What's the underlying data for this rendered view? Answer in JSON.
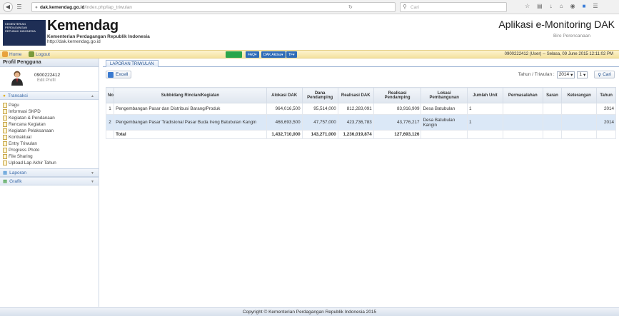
{
  "browser": {
    "url_host": "dak.kemendag.go.id",
    "url_path": "/index.php/lap_triwulan",
    "search_placeholder": "Cari"
  },
  "header": {
    "brand_title": "Kemendag",
    "brand_subtitle": "Kementerian Perdagangan Republik Indonesia",
    "brand_url": "http://dak.kemendag.go.id",
    "app_title": "Aplikasi e-Monitoring DAK",
    "app_subtitle": "Biro Perencanaan"
  },
  "navbar": {
    "home_label": "Home",
    "logout_label": "Logout",
    "pills": [
      "FAQ",
      "DAK Aktiva",
      "TF"
    ],
    "user_status": "0900222412 (User) -- Selasa, 09 June 2015 12:11:02 PM"
  },
  "sidebar": {
    "title": "Profil Pengguna",
    "profile_name": "0900222412",
    "profile_edit": "Edit Profil",
    "section_transaksi": "Transaksi",
    "items": [
      "Pagu",
      "Informasi SKPD",
      "Kegiatan & Pendanaan",
      "Rencana Kegiatan",
      "Kegiatan Pelaksanaan",
      "Kontraktual",
      "Entry Triwulan",
      "Progress Photo",
      "File Sharing",
      "Upload Lap Akhir Tahun"
    ],
    "section_laporan": "Laporan",
    "section_grafik": "Grafik"
  },
  "main": {
    "tab_label": "LAPORAN TRIWULAN",
    "excel_label": "Excell",
    "filter_label": "Tahun / Triwulan :",
    "year_value": "2014",
    "quarter_value": "1",
    "cari_label": "Cari",
    "headers": [
      "No",
      "Subbidang Rincian/Kegiatan",
      "Alokasi DAK",
      "Dana Pendamping",
      "Realisasi DAK",
      "Realisasi Pendamping",
      "Lokasi Pembangunan",
      "Jumlah Unit",
      "Permasalahan",
      "Saran",
      "Keterangan",
      "Tahun"
    ],
    "rows": [
      {
        "no": "1",
        "kegiatan": "Pengembangan Pasar dan Distribusi Barang/Produk",
        "alokasi": "964,016,500",
        "dana": "95,514,000",
        "realisasi_dak": "812,283,091",
        "realisasi_pend": "83,916,909",
        "lokasi": "Desa Batubulan",
        "unit": "1",
        "tahun": "2014"
      },
      {
        "no": "2",
        "kegiatan": "Pengembangan Pasar Tradisional Pasar Buda Ireng Batubulan Kangin",
        "alokasi": "468,693,500",
        "dana": "47,757,000",
        "realisasi_dak": "423,736,783",
        "realisasi_pend": "43,776,217",
        "lokasi": "Desa Batubulan Kangin",
        "unit": "1",
        "tahun": "2014"
      }
    ],
    "total": {
      "label": "Total",
      "alokasi": "1,432,710,000",
      "dana": "143,271,000",
      "realisasi_dak": "1,236,019,874",
      "realisasi_pend": "127,693,126"
    }
  },
  "footer": {
    "copyright": "Copyright © Kementerian Perdagangan Republik Indonesia 2015"
  }
}
